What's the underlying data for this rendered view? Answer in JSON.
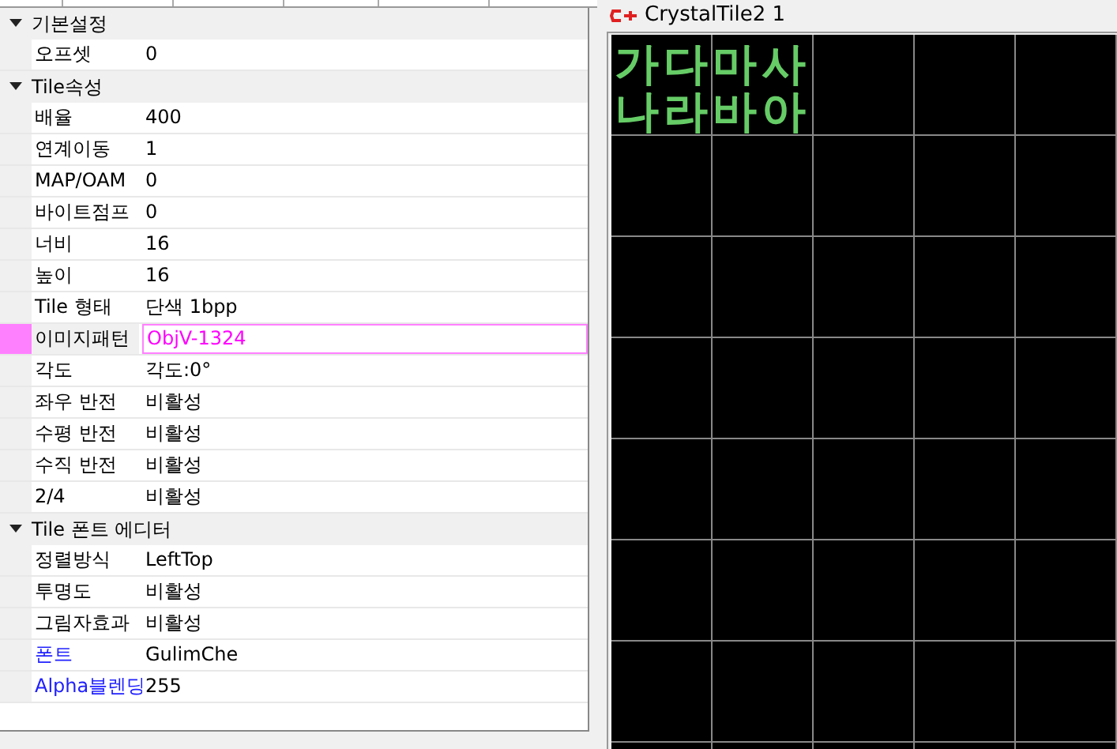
{
  "property_grid": {
    "groups": [
      {
        "title": "기본설정",
        "expanded": true,
        "rows": [
          {
            "name": "오프셋",
            "value": "0",
            "selected": false,
            "emphasized": false
          }
        ]
      },
      {
        "title": "Tile속성",
        "expanded": true,
        "rows": [
          {
            "name": "배율",
            "value": "400",
            "selected": false,
            "emphasized": false
          },
          {
            "name": "연계이동",
            "value": "1",
            "selected": false,
            "emphasized": false
          },
          {
            "name": "MAP/OAM",
            "value": "0",
            "selected": false,
            "emphasized": false
          },
          {
            "name": "바이트점프",
            "value": "0",
            "selected": false,
            "emphasized": false
          },
          {
            "name": "너비",
            "value": "16",
            "selected": false,
            "emphasized": false
          },
          {
            "name": "높이",
            "value": "16",
            "selected": false,
            "emphasized": false
          },
          {
            "name": "Tile 형태",
            "value": "단색 1bpp",
            "selected": false,
            "emphasized": false
          },
          {
            "name": "이미지패턴",
            "value": "ObjV-1324",
            "selected": true,
            "emphasized": false
          },
          {
            "name": "각도",
            "value": "각도:0°",
            "selected": false,
            "emphasized": false
          },
          {
            "name": "좌우 반전",
            "value": "비활성",
            "selected": false,
            "emphasized": false
          },
          {
            "name": "수평 반전",
            "value": "비활성",
            "selected": false,
            "emphasized": false
          },
          {
            "name": "수직 반전",
            "value": "비활성",
            "selected": false,
            "emphasized": false
          },
          {
            "name": "2/4",
            "value": "비활성",
            "selected": false,
            "emphasized": false
          }
        ]
      },
      {
        "title": "Tile 폰트 에디터",
        "expanded": true,
        "rows": [
          {
            "name": "정렬방식",
            "value": "LeftTop",
            "selected": false,
            "emphasized": false
          },
          {
            "name": "투명도",
            "value": "비활성",
            "selected": false,
            "emphasized": false
          },
          {
            "name": "그림자효과",
            "value": "비활성",
            "selected": false,
            "emphasized": false
          },
          {
            "name": "폰트",
            "value": "GulimChe",
            "selected": false,
            "emphasized": true
          },
          {
            "name": "Alpha블렌딩",
            "value": "255",
            "selected": false,
            "emphasized": true
          }
        ]
      }
    ]
  },
  "tile_window": {
    "title": "CrystalTile2 1",
    "tile_text": [
      "가다마사",
      "나라바아"
    ]
  }
}
